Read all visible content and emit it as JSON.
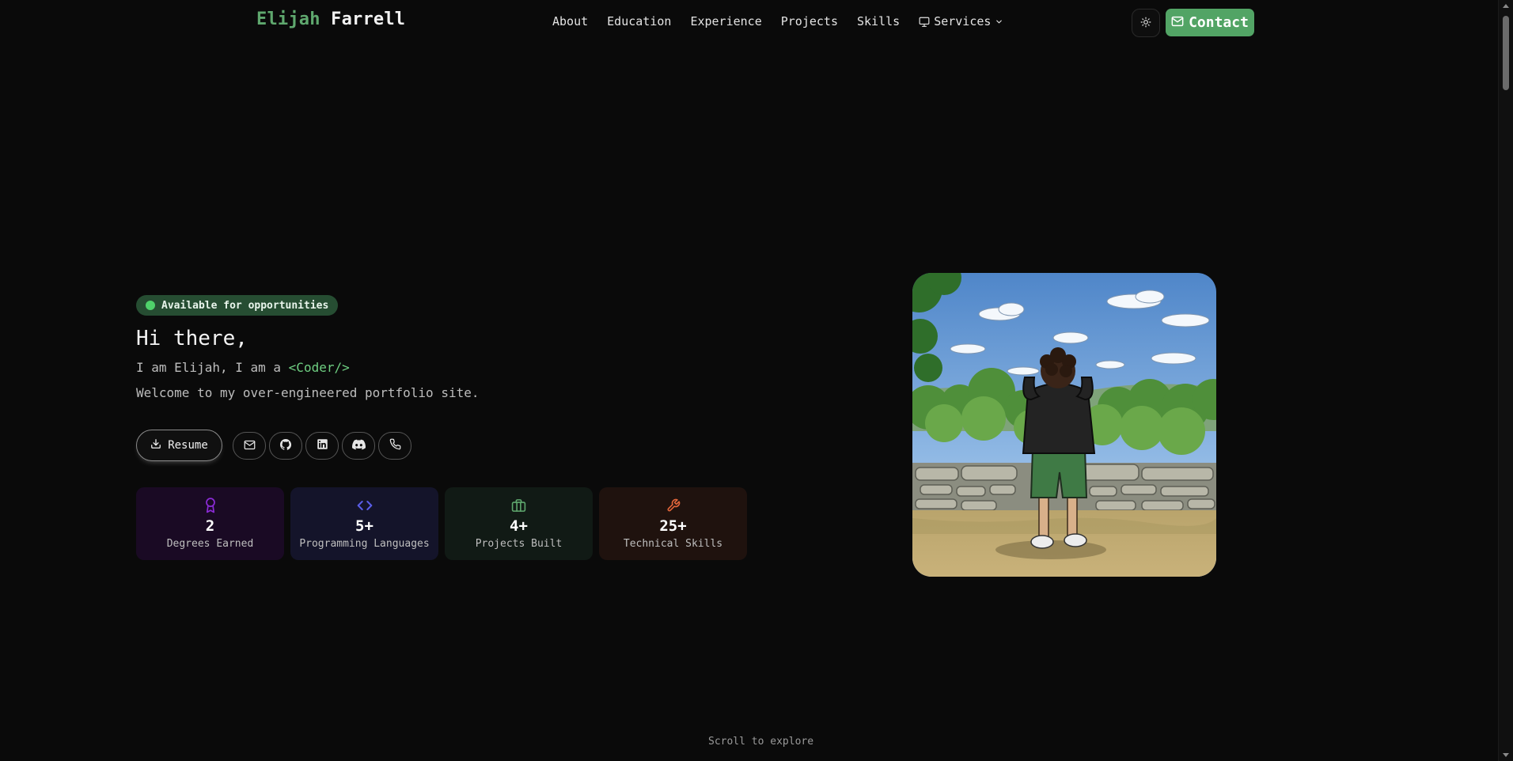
{
  "header": {
    "logo_first": "Elijah",
    "logo_last": "Farrell",
    "nav": [
      "About",
      "Education",
      "Experience",
      "Projects",
      "Skills"
    ],
    "services_label": "Services",
    "contact_label": "Contact"
  },
  "hero": {
    "badge": "Available for opportunities",
    "greeting": "Hi there,",
    "intro_prefix": "I am Elijah, I am a",
    "role": "<Coder/>",
    "welcome": "Welcome to my over-engineered portfolio site.",
    "resume_label": "Resume",
    "social_icons": [
      "mail-icon",
      "github-icon",
      "linkedin-icon",
      "discord-icon",
      "phone-icon"
    ]
  },
  "stats": [
    {
      "value": "2",
      "label": "Degrees Earned",
      "icon": "award-icon",
      "color": "#8b2bd6",
      "bg": "#1a0a24"
    },
    {
      "value": "5+",
      "label": "Programming Languages",
      "icon": "code-icon",
      "color": "#5a5ee8",
      "bg": "#14142a"
    },
    {
      "value": "4+",
      "label": "Projects Built",
      "icon": "briefcase-icon",
      "color": "#5fa86e",
      "bg": "#111a15"
    },
    {
      "value": "25+",
      "label": "Technical Skills",
      "icon": "wrench-icon",
      "color": "#e0653a",
      "bg": "#1f120e"
    }
  ],
  "scroll_hint": "Scroll to explore",
  "colors": {
    "accent": "#52a465",
    "background": "#0a0a0a"
  }
}
